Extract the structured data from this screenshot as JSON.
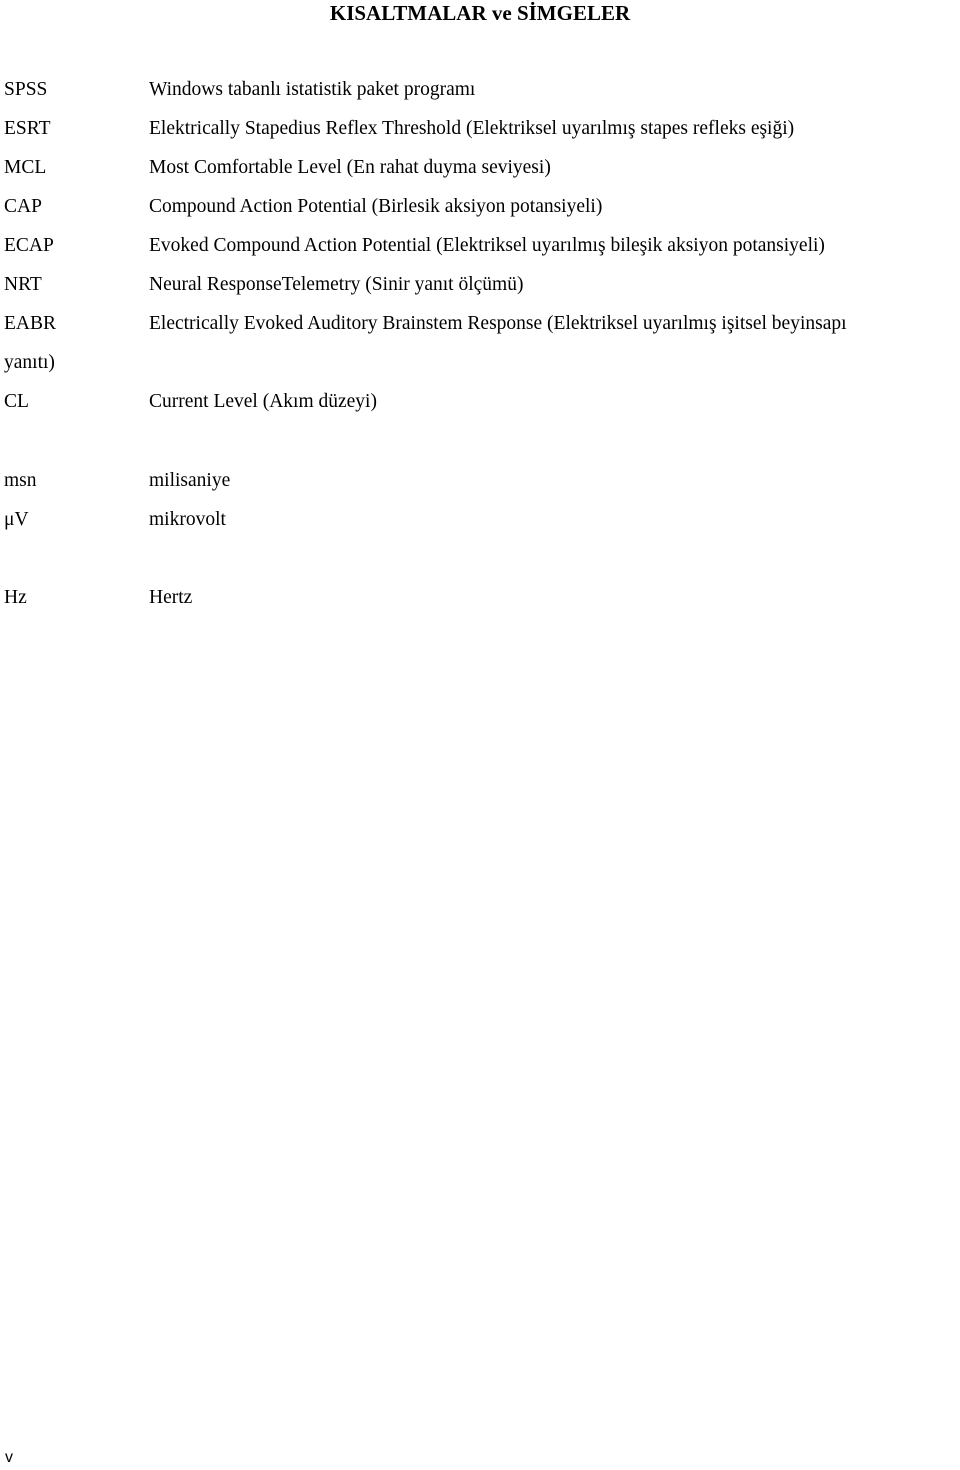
{
  "page": {
    "title": "KISALTMALAR ve SİMGELER",
    "page_number": "v"
  },
  "abbreviations": [
    {
      "abbr": "SPSS",
      "definition": "Windows tabanlı istatistik paket programı"
    },
    {
      "abbr": "ESRT",
      "definition": "Elektrically Stapedius Reflex Threshold (Elektriksel uyarılmış stapes refleks eşiği)"
    },
    {
      "abbr": "MCL",
      "definition": "Most Comfortable Level (En rahat duyma seviyesi)"
    },
    {
      "abbr": "CAP",
      "definition": "Compound Action Potential (Birlesik aksiyon potansiyeli)"
    },
    {
      "abbr": "ECAP",
      "definition": "Evoked Compound Action Potential (Elektriksel uyarılmış bileşik aksiyon potansiyeli)"
    },
    {
      "abbr": "NRT",
      "definition": "Neural ResponseTelemetry (Sinir yanıt ölçümü)"
    },
    {
      "abbr": "EABR",
      "definition": "Electrically Evoked Auditory Brainstem Response (Elektriksel uyarılmış işitsel beyinsapı",
      "continuation": "yanıtı)"
    },
    {
      "abbr": "CL",
      "definition": "Current Level (Akım düzeyi)"
    }
  ],
  "units": [
    {
      "abbr": "msn",
      "definition": "milisaniye"
    },
    {
      "abbr": "μV",
      "definition": "mikrovolt"
    }
  ],
  "frequency_units": [
    {
      "abbr": "Hz",
      "definition": "Hertz"
    }
  ]
}
